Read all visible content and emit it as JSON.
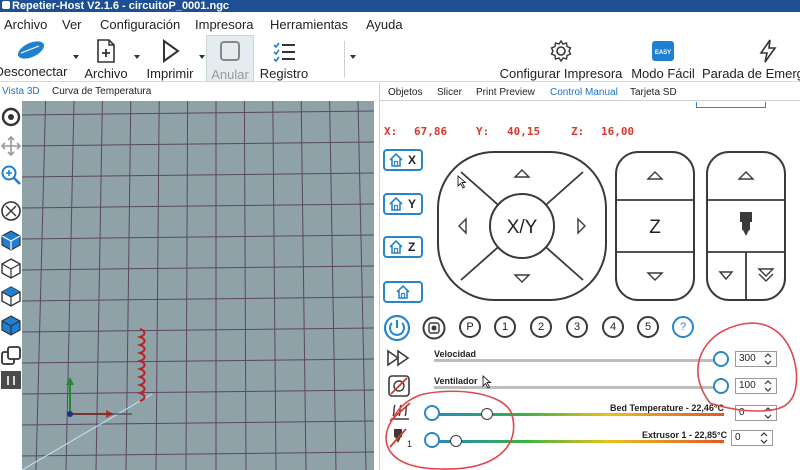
{
  "window": {
    "title": "Repetier-Host V2.1.6 - circuitoP_0001.ngc"
  },
  "menu": [
    "Archivo",
    "Ver",
    "Configuración",
    "Impresora",
    "Herramientas",
    "Ayuda"
  ],
  "toolbar": {
    "disconnect": "Desconectar",
    "file": "Archivo",
    "print": "Imprimir",
    "cancel": "Anular",
    "log": "Registro",
    "configure_printer": "Configurar Impresora",
    "easy_mode": "Modo Fácil",
    "easy_badge": "EASY",
    "emergency_stop": "Parada de Emerg"
  },
  "left_tabs": [
    "Vista 3D",
    "Curva de Temperatura"
  ],
  "right_tabs": [
    "Objetos",
    "Slicer",
    "Print Preview",
    "Control Manual",
    "Tarjeta SD"
  ],
  "coords": {
    "x_label": "X:",
    "x": "67,86",
    "y_label": "Y:",
    "y": "40,15",
    "z_label": "Z:",
    "z": "16,00"
  },
  "home_buttons": [
    "X",
    "Y",
    "Z"
  ],
  "jog": {
    "xy_label": "X/Y",
    "z_label": "Z"
  },
  "number_buttons": [
    "P",
    "1",
    "2",
    "3",
    "4",
    "5",
    "?"
  ],
  "speed": {
    "label": "Velocidad",
    "value": "300"
  },
  "fan": {
    "label": "Ventilador",
    "value": "100"
  },
  "bed": {
    "label": "Bed Temperature - 22,46°C",
    "value": "0"
  },
  "extruder": {
    "label": "Extrusor 1 - 22,85°C",
    "value": "0",
    "index": "1"
  },
  "colors": {
    "accent": "#2a86c6",
    "coord_red": "#d63a2c",
    "annotation_red": "#e0484d",
    "viewport": "#8ea2a8"
  }
}
